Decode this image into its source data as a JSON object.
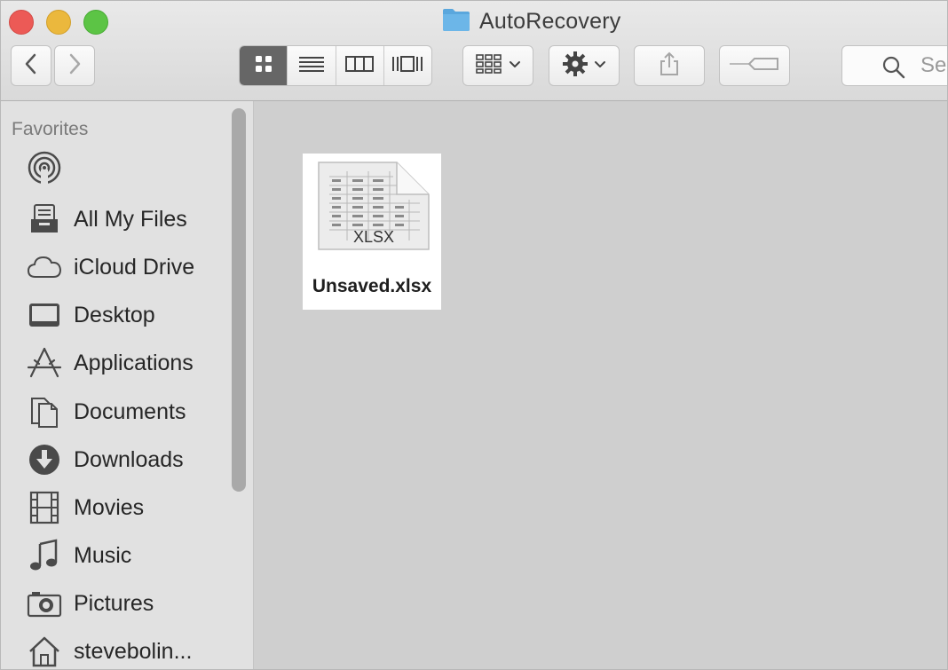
{
  "window": {
    "title": "AutoRecovery",
    "folder_icon": "folder-icon"
  },
  "toolbar": {
    "back_icon": "chevron-left-icon",
    "forward_icon": "chevron-right-icon",
    "view_modes": [
      "icon-view",
      "list-view",
      "column-view",
      "gallery-view"
    ],
    "active_view": "icon-view",
    "arrange_icon": "arrange-grid-icon",
    "action_icon": "gear-icon",
    "share_icon": "share-icon",
    "tags_icon": "tag-icon",
    "search_placeholder": "Sea"
  },
  "sidebar": {
    "section_title": "Favorites",
    "items": [
      {
        "label": "",
        "icon": "airdrop-icon"
      },
      {
        "label": "All My Files",
        "icon": "all-files-icon"
      },
      {
        "label": "iCloud Drive",
        "icon": "cloud-icon"
      },
      {
        "label": "Desktop",
        "icon": "desktop-icon"
      },
      {
        "label": "Applications",
        "icon": "applications-icon"
      },
      {
        "label": "Documents",
        "icon": "documents-icon"
      },
      {
        "label": "Downloads",
        "icon": "downloads-icon"
      },
      {
        "label": "Movies",
        "icon": "film-icon"
      },
      {
        "label": "Music",
        "icon": "music-note-icon"
      },
      {
        "label": "Pictures",
        "icon": "camera-icon"
      },
      {
        "label": "stevebolin...",
        "icon": "home-icon"
      }
    ]
  },
  "content": {
    "files": [
      {
        "name": "Unsaved.xlsx",
        "thumb_text": "XLSX",
        "icon": "xlsx-file-icon",
        "selected": true
      }
    ]
  },
  "colors": {
    "close": "#ec5a56",
    "minimize": "#ebb83d",
    "zoom": "#5cc445",
    "folder": "#5aa7dd"
  }
}
